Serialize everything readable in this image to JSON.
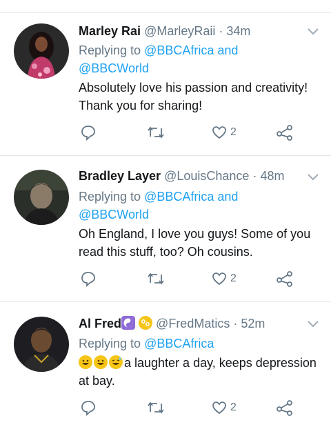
{
  "tweets": [
    {
      "name": "Marley Rai",
      "handle": "@MarleyRaii",
      "time": "34m",
      "replying_prefix": "Replying to",
      "mention1": "@BBCAfrica",
      "conj": "and",
      "mention2": "@BBCWorld",
      "text": "Absolutely love his passion and creativity! Thank you for sharing!",
      "likes": "2"
    },
    {
      "name": "Bradley Layer",
      "handle": "@LouisChance",
      "time": "48m",
      "replying_prefix": "Replying to",
      "mention1": "@BBCAfrica",
      "conj": "and",
      "mention2": "@BBCWorld",
      "text": "Oh England, I love you guys!  Some of you read this stuff, too?  Oh cousins.",
      "likes": "2"
    },
    {
      "name": "Al Fred",
      "handle": "@FredMatics",
      "time": "52m",
      "replying_prefix": "Replying to",
      "mention1": "@BBCAfrica",
      "text": "a laughter a day, keeps depression at bay.",
      "likes": "2",
      "name_emojis": [
        "yin-yang-emoji",
        "cancer-zodiac-emoji"
      ],
      "text_emojis": [
        "grinning-face-emoji",
        "grinning-face-emoji",
        "grinning-squinting-sweat-emoji"
      ]
    }
  ],
  "dot": "·",
  "colors": {
    "link": "#1da1f2",
    "muted": "#657786",
    "divider": "#e1e8ed"
  }
}
